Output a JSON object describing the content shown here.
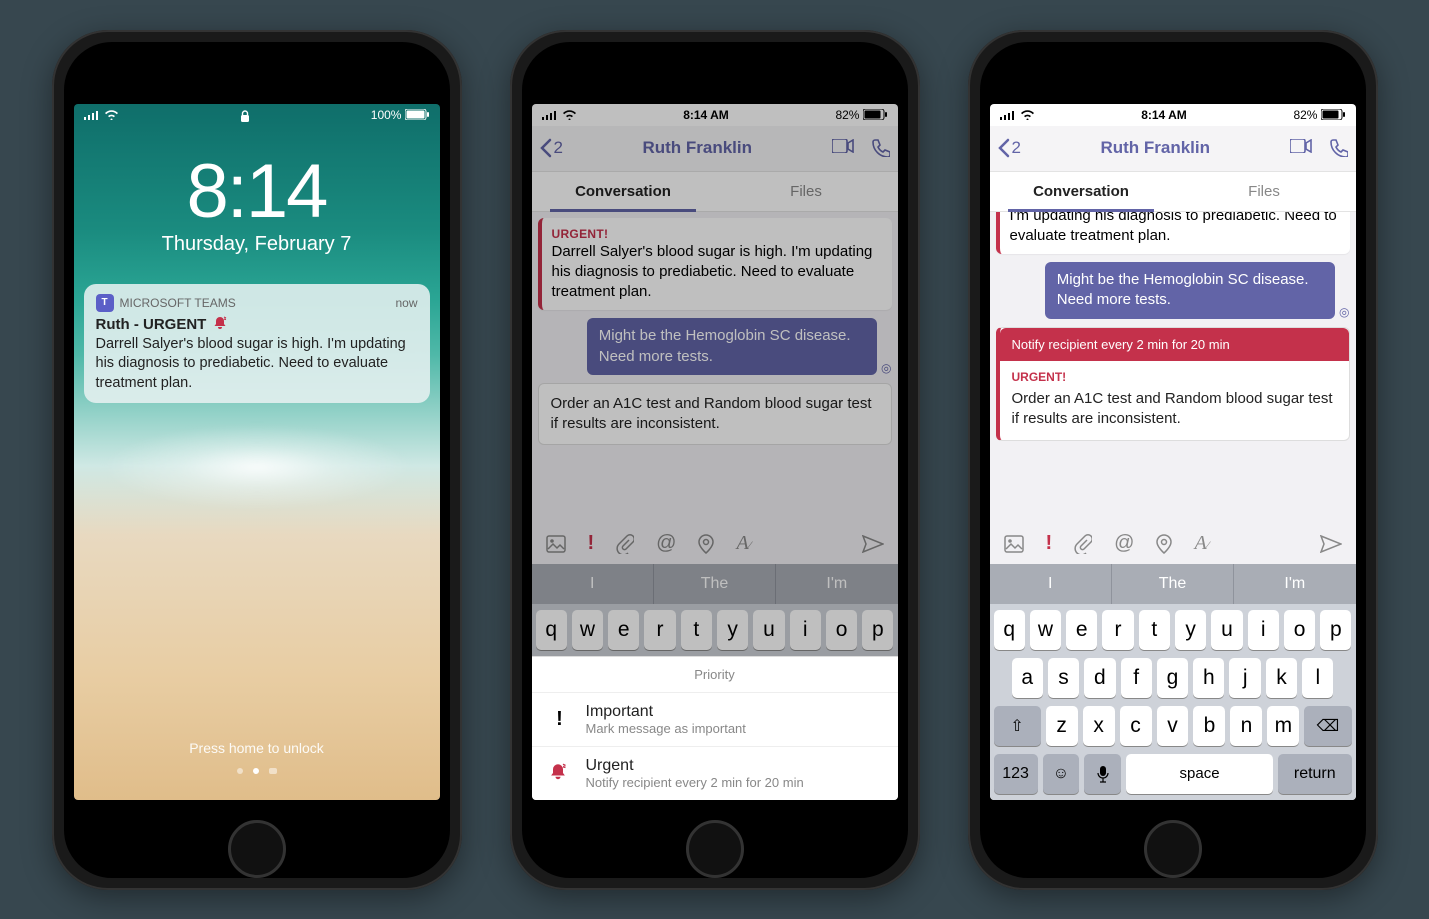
{
  "phone1": {
    "status": {
      "battery": "100%"
    },
    "time": "8:14",
    "date": "Thursday, February 7",
    "notification": {
      "app": "MICROSOFT TEAMS",
      "age": "now",
      "title": "Ruth - URGENT",
      "body": "Darrell Salyer's blood sugar is high. I'm updating his diagnosis to prediabetic. Need to evaluate treatment plan."
    },
    "unlock_hint": "Press home to unlock"
  },
  "phone2": {
    "status": {
      "time": "8:14 AM",
      "battery": "82%"
    },
    "back_count": "2",
    "contact": "Ruth Franklin",
    "tabs": {
      "conversation": "Conversation",
      "files": "Files"
    },
    "urgent_tag": "URGENT!",
    "incoming": "Darrell Salyer's blood sugar is high. I'm updating his diagnosis to prediabetic. Need to evaluate treatment plan.",
    "outgoing": "Might be the Hemoglobin SC disease. Need more tests.",
    "compose": "Order an A1C test and Random blood sugar test if results are inconsistent.",
    "suggestions": [
      "I",
      "The",
      "I'm"
    ],
    "sheet": {
      "title": "Priority",
      "important": {
        "label": "Important",
        "desc": "Mark message as important"
      },
      "urgent": {
        "label": "Urgent",
        "desc": "Notify recipient every 2 min for 20 min"
      }
    }
  },
  "phone3": {
    "status": {
      "time": "8:14 AM",
      "battery": "82%"
    },
    "back_count": "2",
    "contact": "Ruth Franklin",
    "tabs": {
      "conversation": "Conversation",
      "files": "Files"
    },
    "incoming_partial": "I'm updating his diagnosis to prediabetic. Need to evaluate treatment plan.",
    "outgoing": "Might be the Hemoglobin SC disease. Need more tests.",
    "banner": "Notify recipient every 2 min for 20 min",
    "urgent_tag": "URGENT!",
    "compose": "Order an A1C test and Random blood sugar test if results are inconsistent.",
    "suggestions": [
      "I",
      "The",
      "I'm"
    ]
  },
  "keyboard": {
    "r1": [
      "q",
      "w",
      "e",
      "r",
      "t",
      "y",
      "u",
      "i",
      "o",
      "p"
    ],
    "r2": [
      "a",
      "s",
      "d",
      "f",
      "g",
      "h",
      "j",
      "k",
      "l"
    ],
    "r3": [
      "z",
      "x",
      "c",
      "v",
      "b",
      "n",
      "m"
    ],
    "num": "123",
    "space": "space",
    "return": "return"
  }
}
